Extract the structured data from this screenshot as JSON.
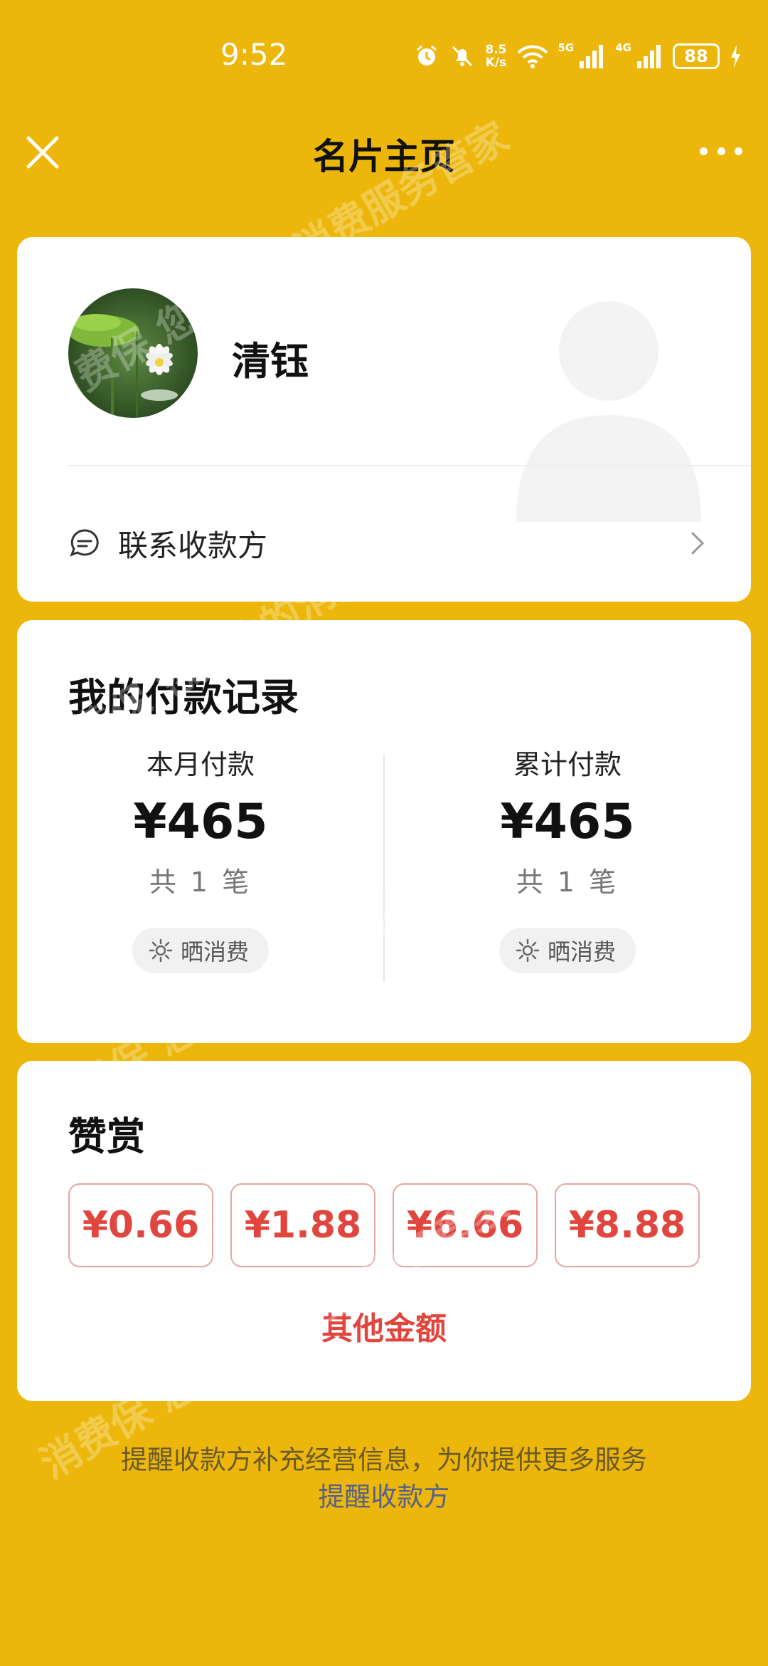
{
  "status_bar": {
    "time": "9:52",
    "net_speed_value": "8.5",
    "net_speed_unit": "K/s",
    "sig1_label": "5G",
    "sig2_label": "4G",
    "battery": "88"
  },
  "header": {
    "title": "名片主页"
  },
  "profile": {
    "name": "清钰",
    "contact_label": "联系收款方"
  },
  "payments": {
    "title": "我的付款记录",
    "month": {
      "label": "本月付款",
      "amount": "¥465",
      "count": "共 1 笔",
      "share": "晒消费"
    },
    "total": {
      "label": "累计付款",
      "amount": "¥465",
      "count": "共 1 笔",
      "share": "晒消费"
    }
  },
  "reward": {
    "title": "赞赏",
    "options": [
      "¥0.66",
      "¥1.88",
      "¥6.66",
      "¥8.88"
    ],
    "other": "其他金额"
  },
  "footer": {
    "tip": "提醒收款方补充经营信息，为你提供更多服务",
    "link": "提醒收款方"
  },
  "watermark": {
    "text_a": "消费保 您身边的消费服务管家"
  },
  "colors": {
    "background": "#ECB70A",
    "accent_red": "#E0463E",
    "link_blue": "#56618a"
  }
}
